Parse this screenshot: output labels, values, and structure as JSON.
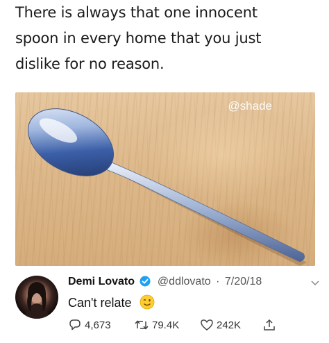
{
  "caption": {
    "line1": "There is always that one innocent",
    "line2": "spoon in every home that you just",
    "line3": "dislike for no reason."
  },
  "photo": {
    "watermark": "@shade",
    "subject_icon": "spoon"
  },
  "tweet": {
    "name": "Demi Lovato",
    "handle": "@ddlovato",
    "separator": "·",
    "date": "7/20/18",
    "text": "Can't relate",
    "emoji_icon": "winking-face-emoji",
    "replies": "4,673",
    "retweets": "79.4K",
    "likes": "242K"
  },
  "colors": {
    "verified_badge": "#1DA1F2",
    "text": "#111111",
    "muted": "#555555"
  }
}
